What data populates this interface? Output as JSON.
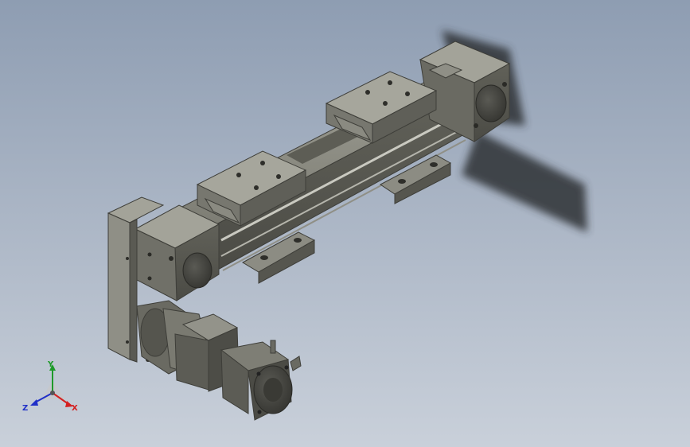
{
  "viewport": {
    "background_top": "#8e9db2",
    "background_bottom": "#c9d0da"
  },
  "model": {
    "body_color": "#6f6f66",
    "body_dark": "#4a4a44",
    "body_light": "#a4a49a",
    "shadow_color": "#2f3236"
  },
  "triad": {
    "x_label": "X",
    "y_label": "Y",
    "z_label": "Z",
    "x_color": "#d42020",
    "y_color": "#1e9a2a",
    "z_color": "#2030c8"
  }
}
